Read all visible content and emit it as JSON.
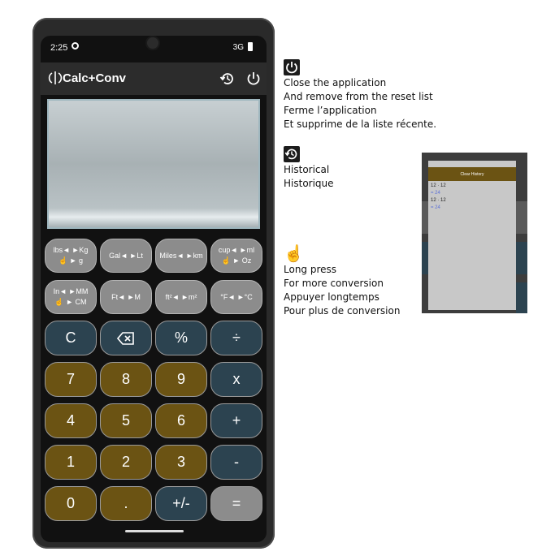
{
  "status": {
    "time": "2:25",
    "network": "3G"
  },
  "app": {
    "title": "Calc+Conv"
  },
  "conversions": [
    {
      "line1": "lbs◄ ►Kg",
      "line2": "☝ ► g"
    },
    {
      "line1": "Gal◄ ►Lt",
      "line2": ""
    },
    {
      "line1": "Miles◄ ►km",
      "line2": ""
    },
    {
      "line1": "cup◄ ►ml",
      "line2": "☝ ► Oz"
    },
    {
      "line1": "In◄ ►MM",
      "line2": "☝ ► CM"
    },
    {
      "line1": "Ft◄ ►M",
      "line2": ""
    },
    {
      "line1": "ft²◄ ►m²",
      "line2": ""
    },
    {
      "line1": "°F◄ ►°C",
      "line2": ""
    }
  ],
  "keys": {
    "clear": "C",
    "percent": "%",
    "divide": "÷",
    "multiply": "x",
    "plus": "+",
    "minus": "-",
    "seven": "7",
    "eight": "8",
    "nine": "9",
    "four": "4",
    "five": "5",
    "six": "6",
    "one": "1",
    "two": "2",
    "three": "3",
    "zero": "0",
    "dot": ".",
    "sign": "+/-",
    "equals": "="
  },
  "legend": {
    "power_text": "Close the application\nAnd remove from the reset list\nFerme l’application\nEt supprime de la liste récente.",
    "history_text": "Historical\nHistorique",
    "longpress_text": "Long press\nFor more conversion\nAppuyer longtemps\nPour plus de conversion"
  },
  "thumbnail": {
    "header": "Clear History",
    "entries": [
      "12 · 12",
      "= 24",
      "12 · 12",
      "= 24"
    ]
  },
  "colors": {
    "dark_key": "#2c4350",
    "olive_key": "#6b5313",
    "grey_key": "#8c8c8c"
  }
}
